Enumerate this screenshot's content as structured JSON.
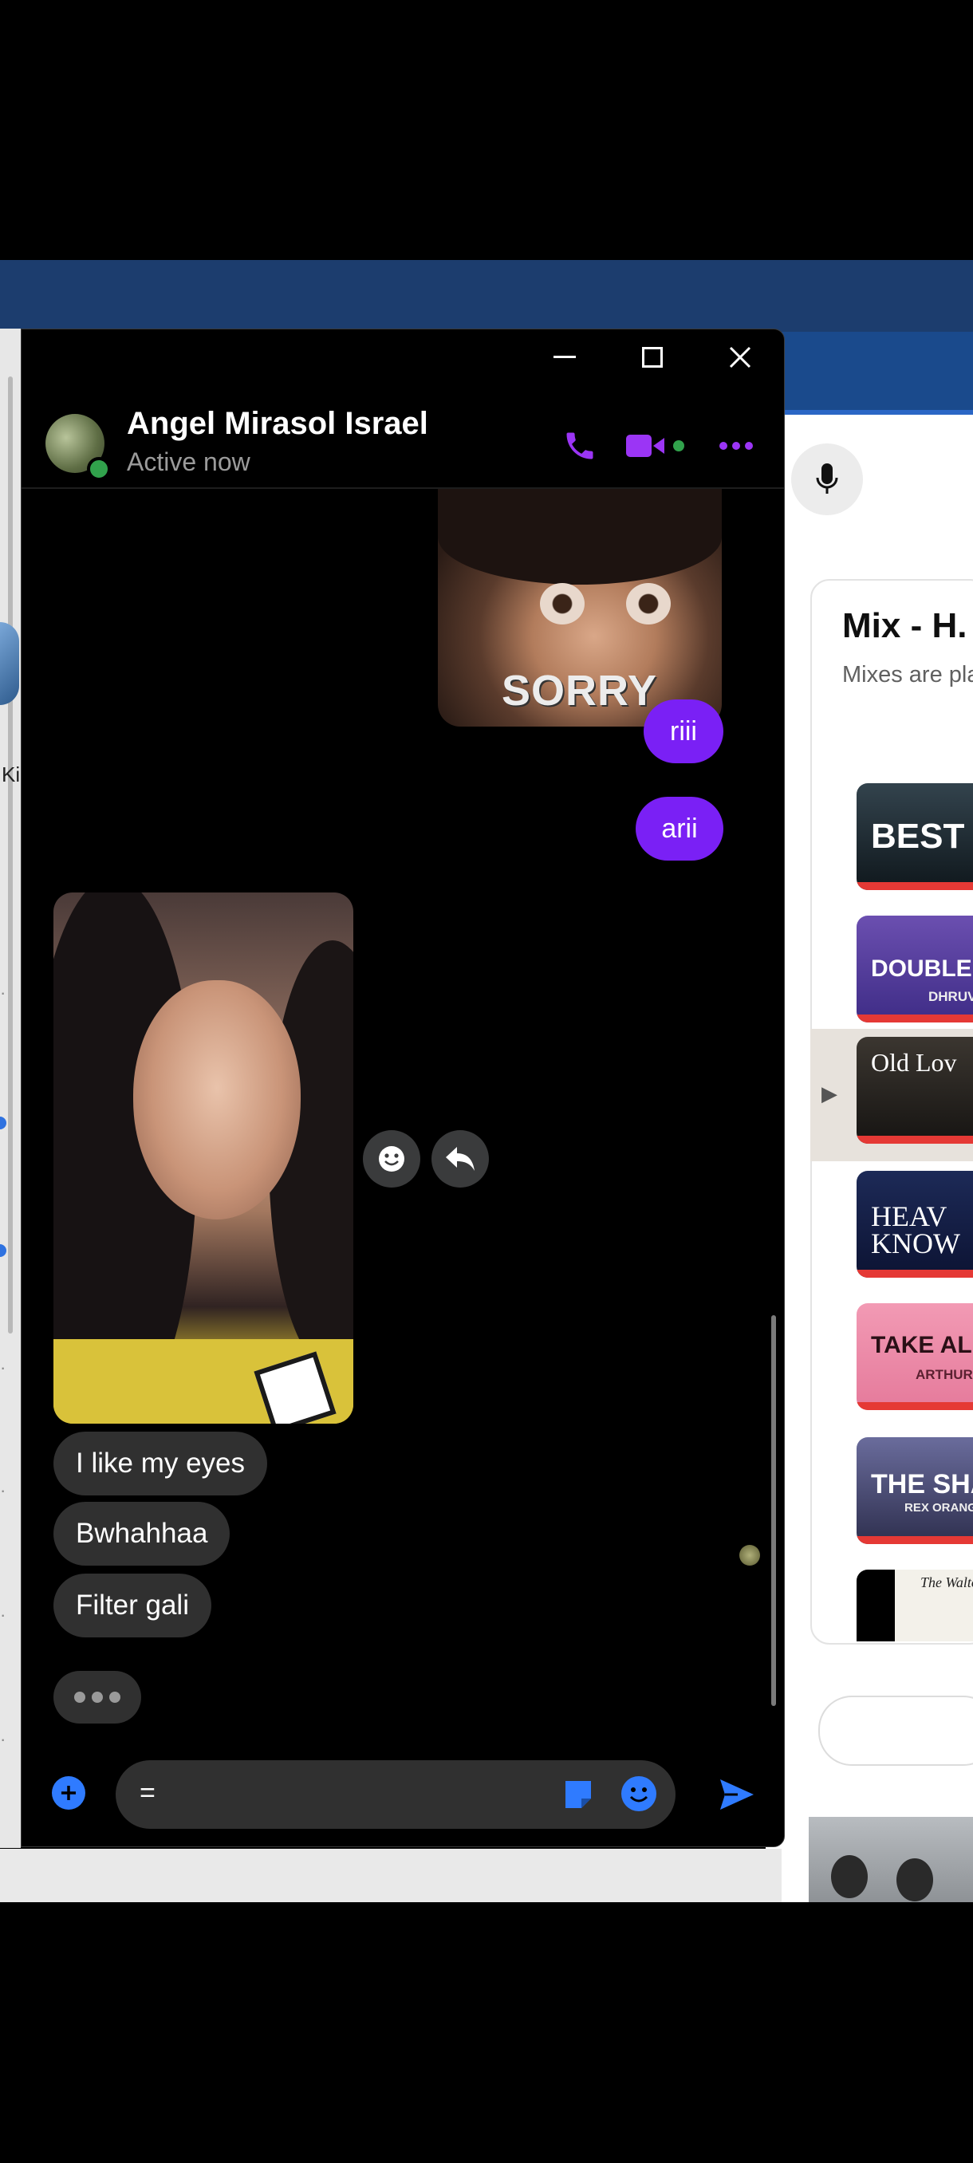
{
  "chat": {
    "contact_name": "Angel Mirasol Israel",
    "status": "Active now",
    "messages_out": [
      "riii",
      "arii"
    ],
    "gif_caption": "SORRY",
    "messages_in": [
      "I like my eyes",
      "Bwhahhaa",
      "Filter gali"
    ],
    "composer_value": "="
  },
  "background": {
    "left_label": "Ki",
    "mix_title": "Mix - H.",
    "mix_subtitle": "Mixes are pla",
    "playing_marker": "▶",
    "thumbs": [
      {
        "title": "BEST P",
        "sub": ""
      },
      {
        "title": "DOUBLE",
        "sub": "DHRUV"
      },
      {
        "title": "Old Lov",
        "sub": ""
      },
      {
        "title": "HEAV KNOW",
        "sub": ""
      },
      {
        "title": "TAKE ALL TH",
        "sub": "ARTHUR NE"
      },
      {
        "title": "THE SHA",
        "sub": "REX ORANGE C"
      },
      {
        "title": "The Walton",
        "sub": ""
      }
    ]
  },
  "colors": {
    "accent_purple": "#7a20f5",
    "messenger_blue": "#2f7bff",
    "online_green": "#31a24c",
    "incoming_bubble": "#303030"
  }
}
